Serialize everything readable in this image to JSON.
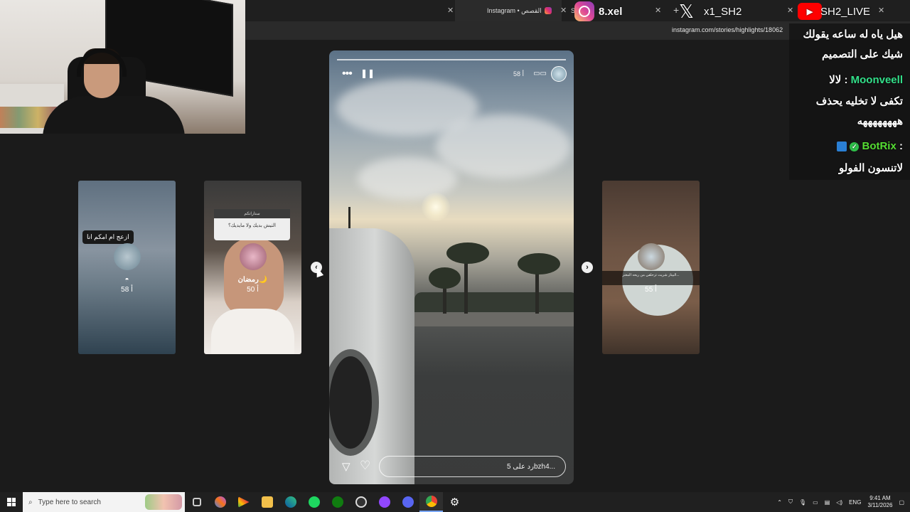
{
  "browser": {
    "tabs": [
      {
        "label": "Instagram • القصص",
        "active": true
      },
      {
        "label": "S",
        "active": false
      }
    ],
    "url": "instagram.com/stories/highlights/18062"
  },
  "social_overlay": {
    "instagram_handle": "8.xel",
    "x_handle": "x1_SH2",
    "youtube_handle": "SH2_LIVE"
  },
  "stories": {
    "left2": {
      "caption": "ازعج ام امكم انا",
      "time": "58 أ"
    },
    "left1": {
      "question_header": "ستاراتكم",
      "question": "النيش بديك ولا مايديك؟",
      "label": "رمضان🌙",
      "time": "50 أ"
    },
    "right1": {
      "banner": "البيتار شريت تزحلقي من ريحه المغتر...",
      "time": "55 أ"
    },
    "main": {
      "time": "58 أ",
      "reply_placeholder": "رد على 5bzh4..."
    }
  },
  "chat": {
    "messages": [
      {
        "name": "",
        "text": "هيل ياه له ساعه يقولك"
      },
      {
        "name": "",
        "text": "شيك على التصميم"
      },
      {
        "name": "Moonveell",
        "text": "لالا"
      },
      {
        "name": "",
        "text": "تكفى لا تخليه يحذف"
      },
      {
        "name": "",
        "text": "ههههههههه"
      },
      {
        "name": "BotRix",
        "text": ""
      },
      {
        "name": "",
        "text": "لاتنسون الفولو"
      }
    ]
  },
  "taskbar": {
    "search_placeholder": "Type here to search",
    "language": "ENG",
    "time": "9:41 AM",
    "date": "3/11/2026"
  },
  "colors": {
    "accent_green": "#33e08a",
    "botrix_green": "#55dd33",
    "taskbar_bg": "#202020"
  }
}
